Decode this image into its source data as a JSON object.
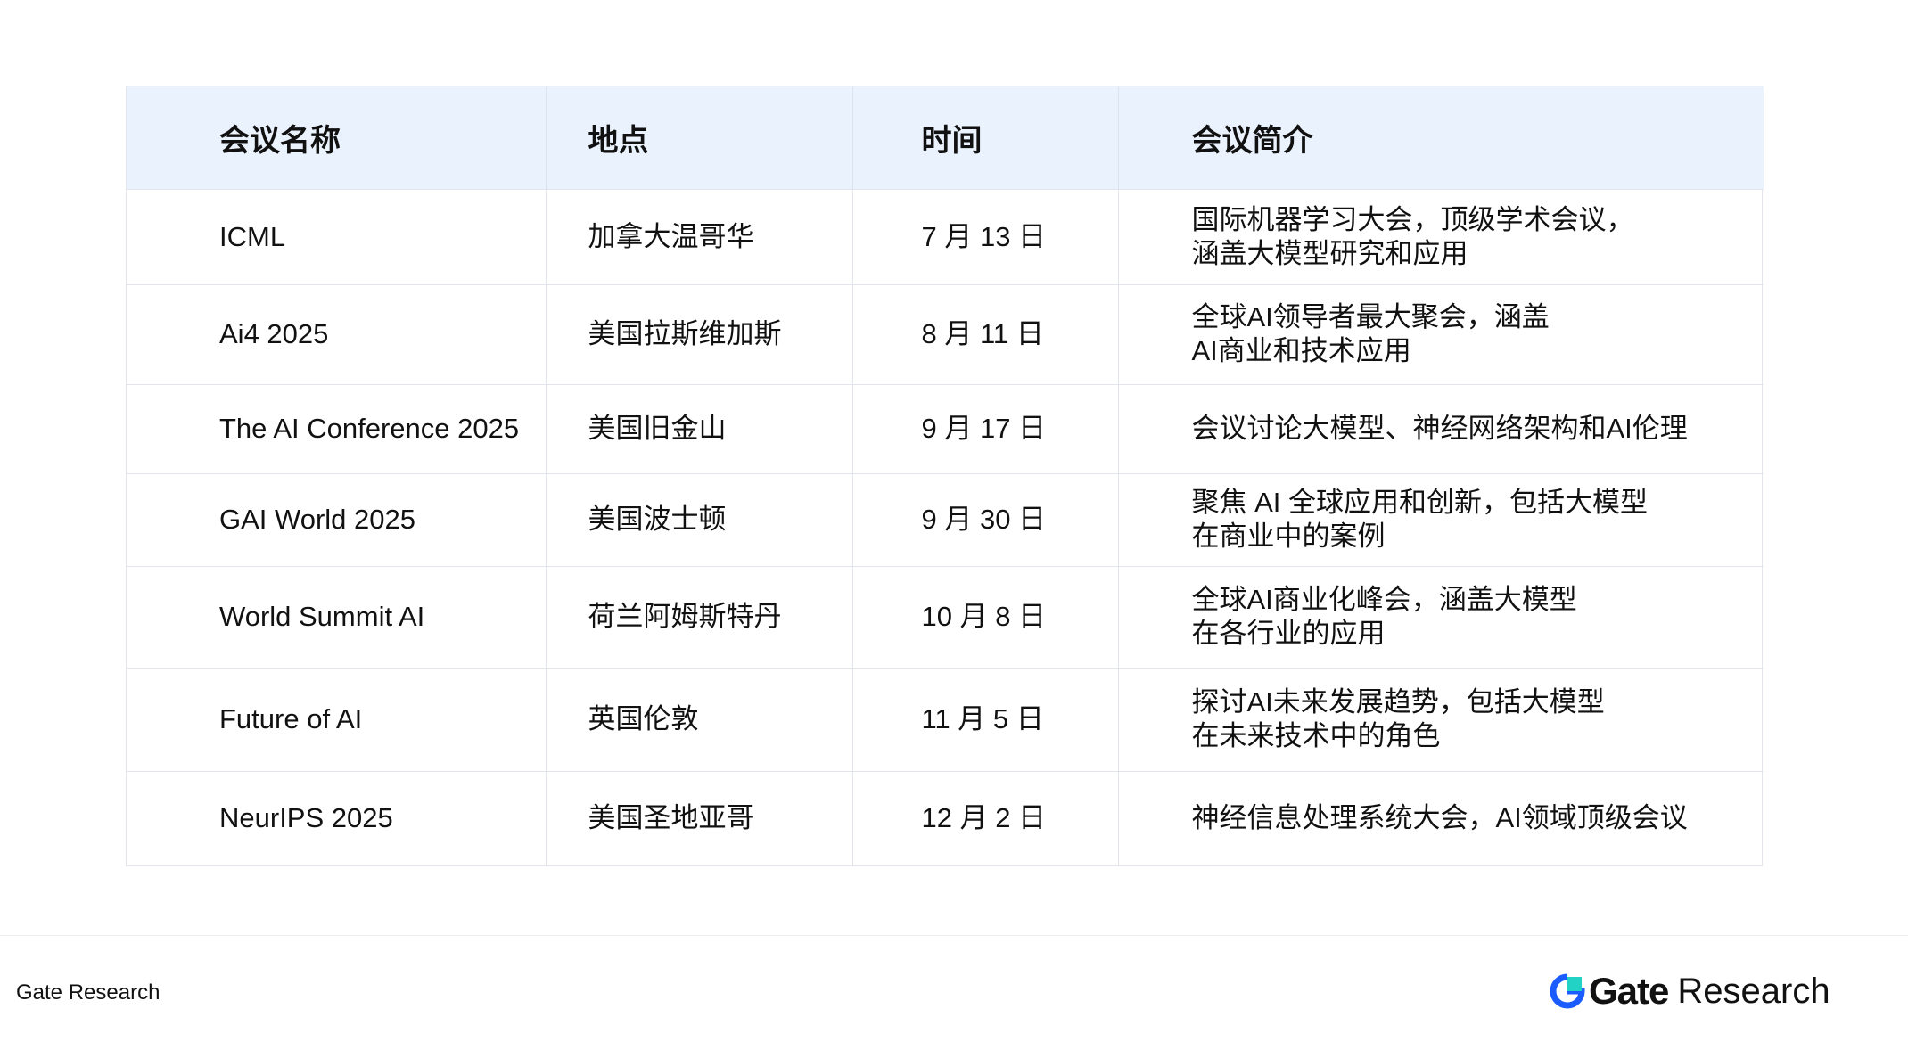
{
  "table": {
    "headers": [
      "会议名称",
      "地点",
      "时间",
      "会议简介"
    ],
    "rows": [
      {
        "name": "ICML",
        "location": "加拿大温哥华",
        "date": "7 月 13 日",
        "desc": [
          "国际机器学习大会，顶级学术会议，",
          "涵盖大模型研究和应用"
        ]
      },
      {
        "name": "Ai4 2025",
        "location": "美国拉斯维加斯",
        "date": "8 月 11 日",
        "desc": [
          "全球AI领导者最大聚会，涵盖",
          "AI商业和技术应用"
        ]
      },
      {
        "name": "The AI Conference 2025",
        "location": "美国旧金山",
        "date": "9 月 17 日",
        "desc": [
          "会议讨论大模型、神经网络架构和AI伦理"
        ]
      },
      {
        "name": "GAI World 2025",
        "location": "美国波士顿",
        "date": "9 月 30 日",
        "desc": [
          "聚焦 AI 全球应用和创新，包括大模型",
          "在商业中的案例"
        ]
      },
      {
        "name": "World Summit AI",
        "location": "荷兰阿姆斯特丹",
        "date": "10 月 8 日",
        "desc": [
          "全球AI商业化峰会，涵盖大模型",
          "在各行业的应用"
        ]
      },
      {
        "name": "Future of AI",
        "location": "英国伦敦",
        "date": "11 月 5 日",
        "desc": [
          "探讨AI未来发展趋势，包括大模型",
          "在未来技术中的角色"
        ]
      },
      {
        "name": "NeurIPS 2025",
        "location": "美国圣地亚哥",
        "date": "12 月 2 日",
        "desc": [
          "神经信息处理系统大会，AI领域顶级会议"
        ]
      }
    ]
  },
  "footer": {
    "source": "Gate Research",
    "logo_gate": "Gate",
    "logo_research": "Research"
  },
  "colors": {
    "header_bg": "#eaf2fd",
    "logo_blue": "#1a5cff",
    "logo_cyan": "#22d3c5"
  }
}
